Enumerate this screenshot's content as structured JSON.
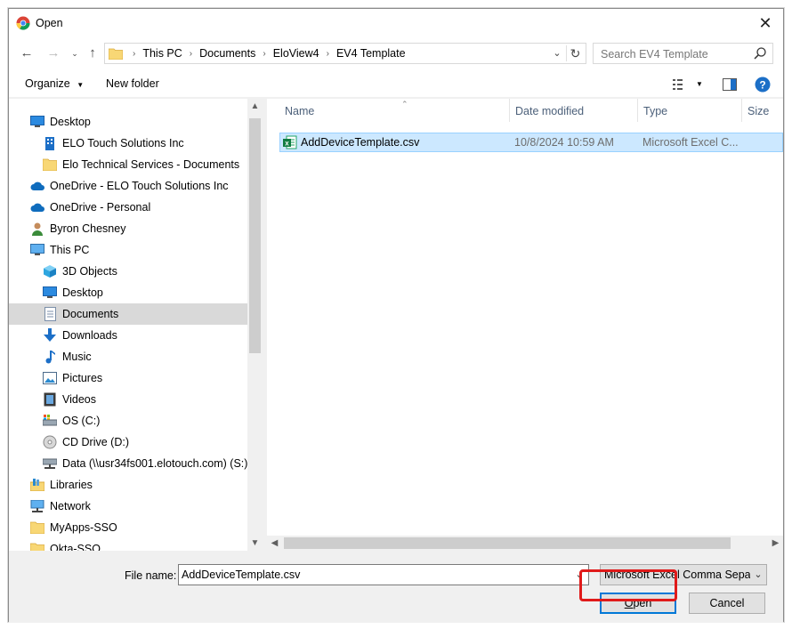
{
  "window": {
    "title": "Open"
  },
  "address": {
    "crumbs": [
      "This PC",
      "Documents",
      "EloView4",
      "EV4 Template"
    ],
    "search_placeholder": "Search EV4 Template"
  },
  "toolbar": {
    "organize": "Organize",
    "new_folder": "New folder"
  },
  "sidebar": {
    "items": [
      {
        "label": "Desktop",
        "icon": "desktop-icon",
        "indent": 0
      },
      {
        "label": "ELO Touch Solutions Inc",
        "icon": "building-icon",
        "indent": 1
      },
      {
        "label": "Elo Technical Services - Documents",
        "icon": "folder-icon",
        "indent": 1
      },
      {
        "label": "OneDrive - ELO Touch Solutions Inc",
        "icon": "cloud-icon",
        "indent": 0
      },
      {
        "label": "OneDrive - Personal",
        "icon": "cloud-icon",
        "indent": 0
      },
      {
        "label": "Byron Chesney",
        "icon": "user-icon",
        "indent": 0
      },
      {
        "label": "This PC",
        "icon": "computer-icon",
        "indent": 0
      },
      {
        "label": "3D Objects",
        "icon": "cube-icon",
        "indent": 1
      },
      {
        "label": "Desktop",
        "icon": "desktop-icon",
        "indent": 1
      },
      {
        "label": "Documents",
        "icon": "document-icon",
        "indent": 1,
        "selected": true
      },
      {
        "label": "Downloads",
        "icon": "download-icon",
        "indent": 1
      },
      {
        "label": "Music",
        "icon": "music-icon",
        "indent": 1
      },
      {
        "label": "Pictures",
        "icon": "pictures-icon",
        "indent": 1
      },
      {
        "label": "Videos",
        "icon": "video-icon",
        "indent": 1
      },
      {
        "label": "OS (C:)",
        "icon": "drive-icon",
        "indent": 1
      },
      {
        "label": "CD Drive (D:)",
        "icon": "cd-icon",
        "indent": 1
      },
      {
        "label": "Data (\\\\usr34fs001.elotouch.com) (S:)",
        "icon": "network-drive-icon",
        "indent": 1
      },
      {
        "label": "Libraries",
        "icon": "library-icon",
        "indent": 0
      },
      {
        "label": "Network",
        "icon": "network-icon",
        "indent": 0
      },
      {
        "label": "MyApps-SSO",
        "icon": "folder-icon",
        "indent": 0
      },
      {
        "label": "Okta-SSO",
        "icon": "folder-icon",
        "indent": 0
      }
    ]
  },
  "files": {
    "columns": [
      "Name",
      "Date modified",
      "Type",
      "Size"
    ],
    "rows": [
      {
        "name": "AddDeviceTemplate.csv",
        "date": "10/8/2024 10:59 AM",
        "type": "Microsoft Excel C...",
        "size": ""
      }
    ]
  },
  "bottom": {
    "file_name_label": "File name:",
    "file_name_value": "AddDeviceTemplate.csv",
    "file_type": "Microsoft Excel Comma Separated Values File",
    "open_label": "Open",
    "cancel_label": "Cancel"
  },
  "colors": {
    "selection": "#cce8ff",
    "accent": "#0078d7",
    "highlight": "#e01a1a"
  }
}
